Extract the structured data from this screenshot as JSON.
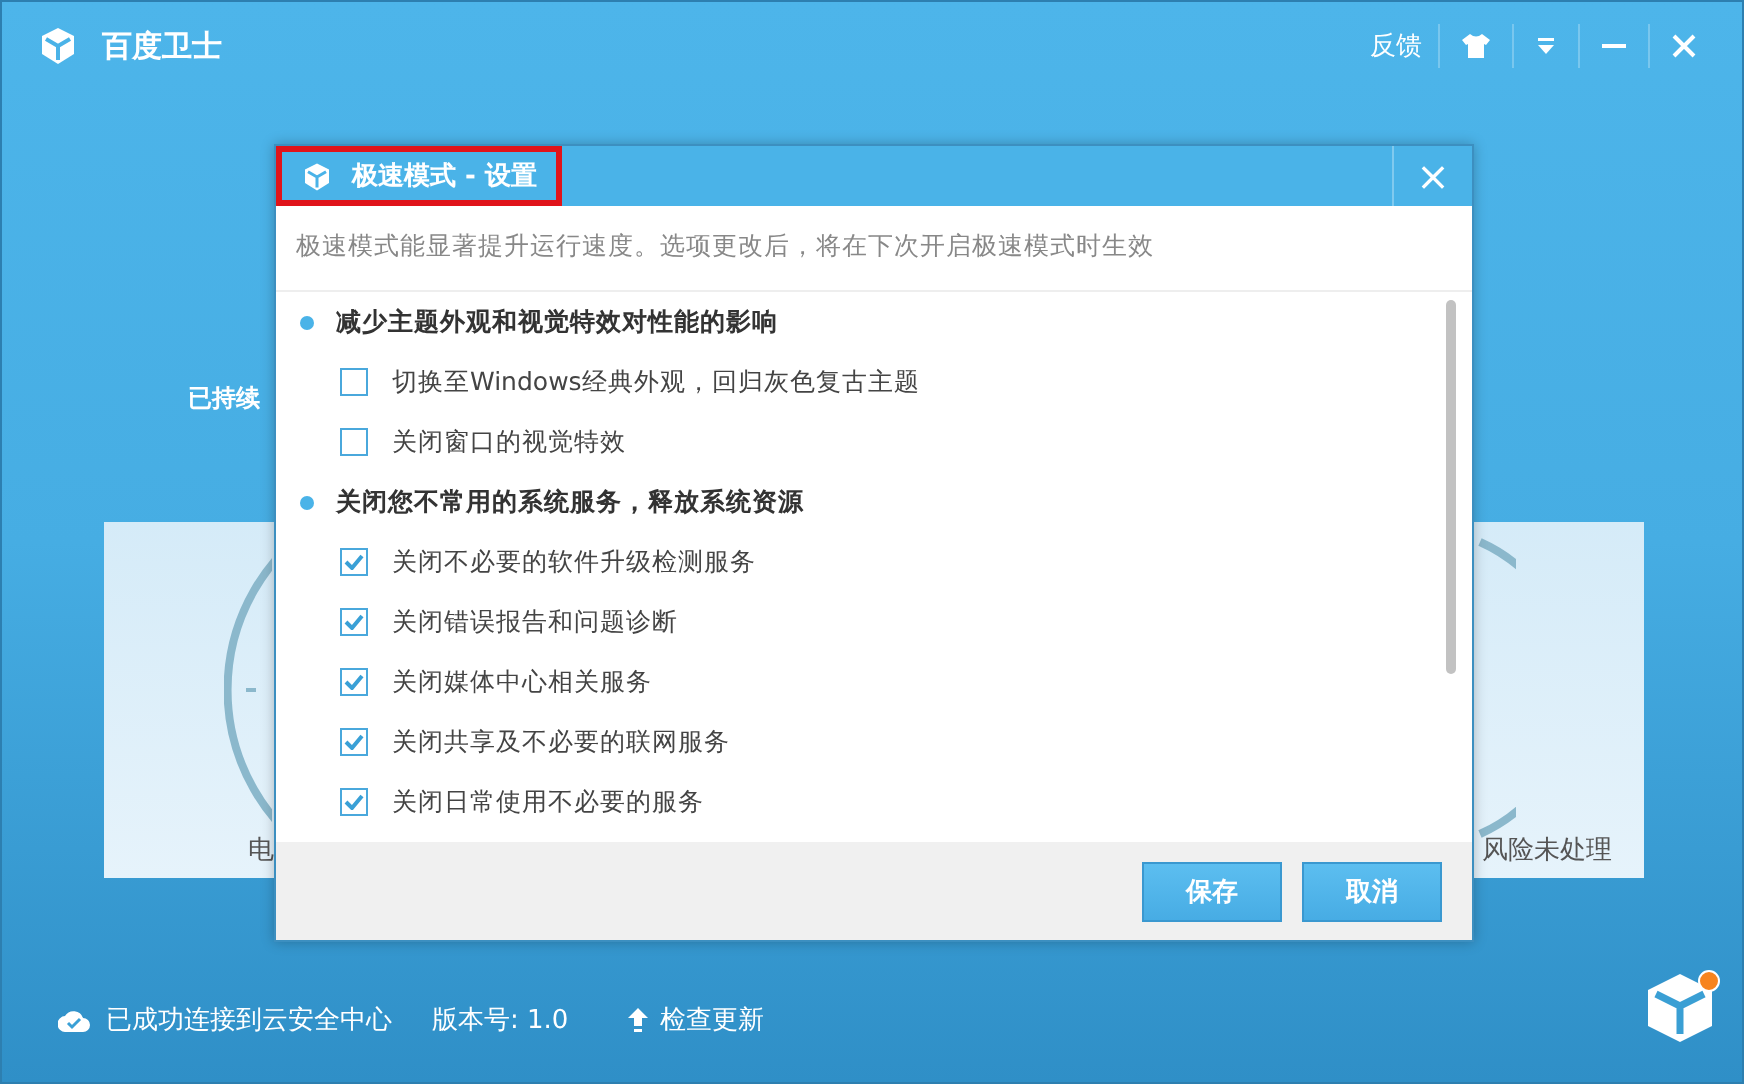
{
  "app": {
    "title": "百度卫士",
    "feedback": "反馈"
  },
  "background": {
    "subline": "已持续",
    "card_left_label": "电",
    "card_right_label": "风险未处理"
  },
  "dialog": {
    "title": "极速模式 - 设置",
    "title_highlighted": true,
    "close": "×",
    "description": "极速模式能显著提升运行速度。选项更改后，将在下次开启极速模式时生效",
    "sections": [
      {
        "title": "减少主题外观和视觉特效对性能的影响",
        "items": [
          {
            "label": "切换至Windows经典外观，回归灰色复古主题",
            "checked": false
          },
          {
            "label": "关闭窗口的视觉特效",
            "checked": false
          }
        ]
      },
      {
        "title": "关闭您不常用的系统服务，释放系统资源",
        "items": [
          {
            "label": "关闭不必要的软件升级检测服务",
            "checked": true
          },
          {
            "label": "关闭错误报告和问题诊断",
            "checked": true
          },
          {
            "label": "关闭媒体中心相关服务",
            "checked": true
          },
          {
            "label": "关闭共享及不必要的联网服务",
            "checked": true
          },
          {
            "label": "关闭日常使用不必要的服务",
            "checked": true
          }
        ]
      }
    ],
    "buttons": [
      {
        "label": "保存"
      },
      {
        "label": "取消"
      }
    ]
  },
  "status_bar": {
    "connection": "已成功连接到云安全中心",
    "version": "版本号: 1.0",
    "update": "检查更新",
    "notification": true
  }
}
